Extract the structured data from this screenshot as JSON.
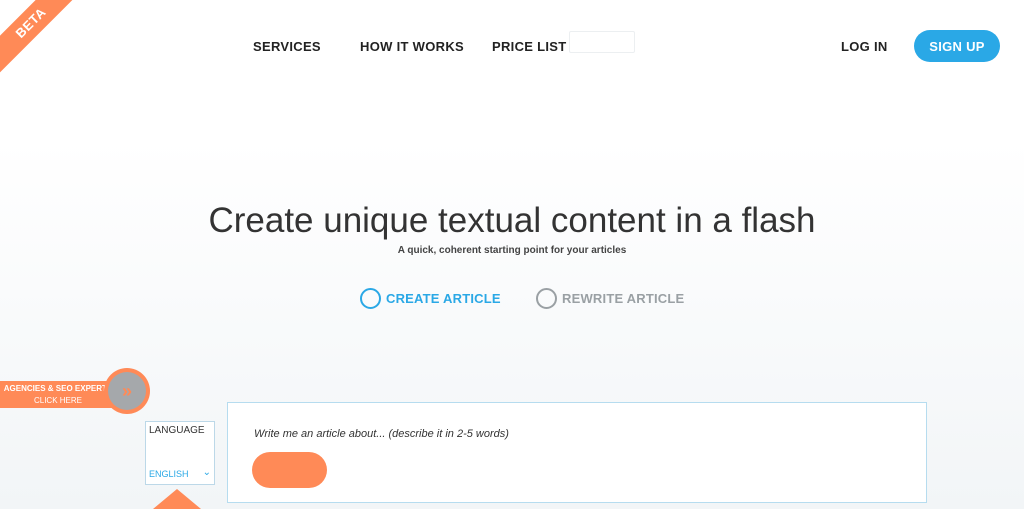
{
  "badge": {
    "label": "BETA"
  },
  "nav": {
    "services": "SERVICES",
    "how_it_works": "HOW IT WORKS",
    "price_list": "PRICE LIST",
    "login": "LOG IN",
    "signup": "SIGN UP"
  },
  "hero": {
    "title": "Create unique textual content in a flash",
    "subtitle": "A quick, coherent starting point for your articles"
  },
  "mode_options": [
    {
      "label": "CREATE ARTICLE",
      "selected": true
    },
    {
      "label": "REWRITE ARTICLE",
      "selected": false
    }
  ],
  "agency_banner": {
    "line1": "AGENCIES & SEO EXPERTS",
    "line2": "CLICK HERE",
    "icon": "double-chevron-right-icon"
  },
  "language": {
    "title": "LANGUAGE",
    "selected": "ENGLISH"
  },
  "article_form": {
    "placeholder": "Write me an article about... (describe it in 2-5 words)",
    "value": ""
  },
  "colors": {
    "accent_blue": "#2aa8e6",
    "accent_orange": "#ff8a57"
  }
}
